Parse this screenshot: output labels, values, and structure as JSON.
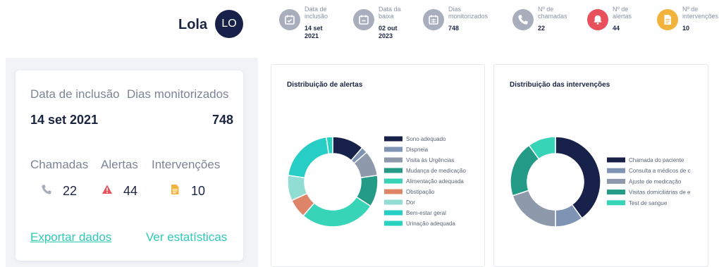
{
  "header": {
    "patient_name": "Lola",
    "avatar_initials": "LO",
    "stats": [
      {
        "label_lines": [
          "Data de",
          "inclusão"
        ],
        "value_lines": [
          "14 set",
          "2021"
        ],
        "icon": "calendar-check-icon",
        "color": "#a9aebd"
      },
      {
        "label_lines": [
          "Data da",
          "baixa"
        ],
        "value_lines": [
          "02 out",
          "2023"
        ],
        "icon": "calendar-minus-icon",
        "color": "#a9aebd"
      },
      {
        "label_lines": [
          "Dias",
          "monitorizados"
        ],
        "value_lines": [
          "748"
        ],
        "icon": "calendar-grid-icon",
        "color": "#a9aebd"
      },
      {
        "label_lines": [
          "Nº de",
          "chamadas"
        ],
        "value_lines": [
          "22"
        ],
        "icon": "phone-icon",
        "color": "#a9aebd"
      },
      {
        "label_lines": [
          "Nº de",
          "alertas"
        ],
        "value_lines": [
          "44"
        ],
        "icon": "bell-icon",
        "color": "#e8505b"
      },
      {
        "label_lines": [
          "Nº de",
          "intervenções"
        ],
        "value_lines": [
          "10"
        ],
        "icon": "document-icon",
        "color": "#f2b33d"
      }
    ]
  },
  "summary": {
    "inclusion_label": "Data de inclusão",
    "inclusion_value": "14 set 2021",
    "days_label": "Dias monitorizados",
    "days_value": "748",
    "calls_label": "Chamadas",
    "calls_value": "22",
    "alerts_label": "Alertas",
    "alerts_value": "44",
    "interventions_label": "Intervenções",
    "interventions_value": "10",
    "export_link": "Exportar dados",
    "stats_link": "Ver estatísticas",
    "colors": {
      "phone": "#a9aebd",
      "alert": "#e8505b",
      "intervention": "#f2b33d",
      "accent": "#2fc9b7"
    }
  },
  "chart_data": [
    {
      "type": "pie",
      "title": "Distribuição de alertas",
      "donut": true,
      "legend_position": "right",
      "categories": [
        "Sono adequado",
        "Dispneia",
        "Visita às Urgências",
        "Mudança de medicação",
        "Alimentação adequada",
        "Obstipação",
        "Dor",
        "Bem-estar geral",
        "Urinação adequada"
      ],
      "values": [
        5,
        1,
        4,
        5,
        12,
        3,
        4,
        9,
        1
      ],
      "colors": [
        "#172149",
        "#7f93b5",
        "#8e9aab",
        "#239b86",
        "#38d4b8",
        "#de8469",
        "#91dcd3",
        "#27cec6",
        "#29d1bf"
      ]
    },
    {
      "type": "pie",
      "title": "Distribuição das intervenções",
      "donut": true,
      "legend_position": "right",
      "categories": [
        "Chamada do paciente",
        "Consulta a médicos de c",
        "Ajuste de medicação",
        "Visitas domiciliárias de e",
        "Test de sangue"
      ],
      "values": [
        4,
        1,
        2,
        2,
        1
      ],
      "colors": [
        "#172149",
        "#7f93b5",
        "#8e9aab",
        "#239b86",
        "#38d4b8"
      ]
    }
  ]
}
